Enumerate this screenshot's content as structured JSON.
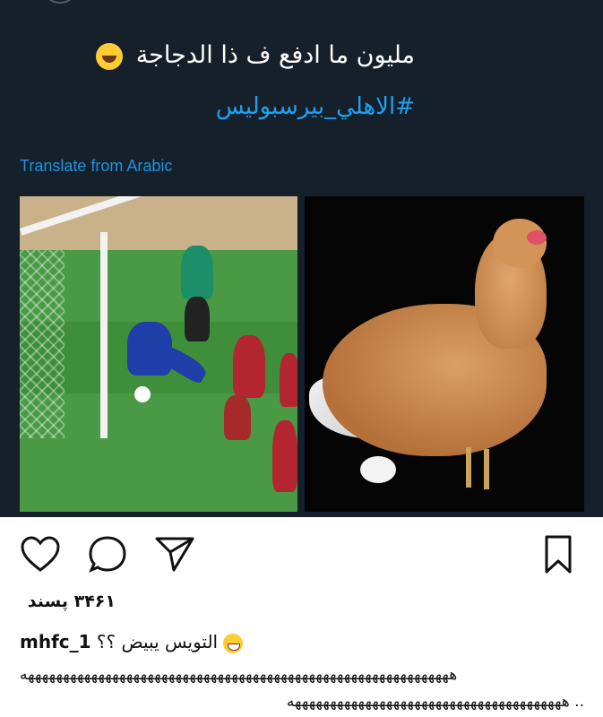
{
  "tweet": {
    "text": "مليون ما ادفع ف ذا الدجاجة",
    "hashtag": "#الاهلي_بيرسبوليس",
    "translate_label": "Translate from Arabic",
    "emoji": "laughing-tears-emoji"
  },
  "images": {
    "left": "soccer-goal-scene",
    "right": "chicken-with-egg"
  },
  "actions": {
    "like_icon": "heart-icon",
    "comment_icon": "comment-bubble-icon",
    "share_icon": "paper-plane-icon",
    "save_icon": "bookmark-icon"
  },
  "post": {
    "likes_text": "۳۴۶۱ پسند",
    "username": "mhfc_1",
    "caption": "التويس يبيض ؟؟",
    "caption_emoji": "grinning-emoji",
    "laugh_line_1": "هههههههههههههههههههههههههههههههههههههههههههههههههههههههههههههه",
    "laugh_line_2": "هههههههههههههههههههههههههههههههههههههههه .."
  },
  "colors": {
    "tweet_bg": "#15202b",
    "hashtag": "#1da1f2",
    "translate": "#1b95e0"
  }
}
